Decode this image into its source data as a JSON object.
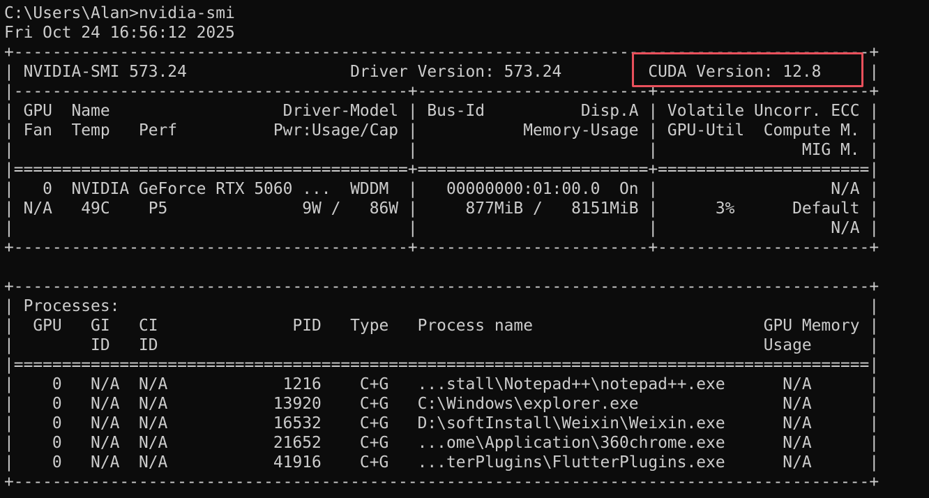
{
  "prompt": {
    "command_line": "C:\\Users\\Alan>nvidia-smi",
    "timestamp": "Fri Oct 24 16:56:12 2025"
  },
  "gpu_table": {
    "lines": [
      "+-----------------------------------------------------------------------------------------+",
      "| NVIDIA-SMI 573.24                 Driver Version: 573.24         CUDA Version: 12.8     |",
      "|-----------------------------------------+------------------------+----------------------+",
      "| GPU  Name                  Driver-Model | Bus-Id          Disp.A | Volatile Uncorr. ECC |",
      "| Fan  Temp   Perf          Pwr:Usage/Cap |           Memory-Usage | GPU-Util  Compute M. |",
      "|                                         |                        |               MIG M. |",
      "|=========================================+========================+======================|",
      "|   0  NVIDIA GeForce RTX 5060 ...  WDDM  |   00000000:01:00.0  On |                  N/A |",
      "| N/A   49C    P5              9W /   86W |     877MiB /   8151MiB |      3%      Default |",
      "|                                         |                        |                  N/A |",
      "+-----------------------------------------+------------------------+----------------------+"
    ]
  },
  "processes_table": {
    "lines": [
      "+-----------------------------------------------------------------------------------------+",
      "| Processes:                                                                              |",
      "|  GPU   GI   CI              PID   Type   Process name                        GPU Memory |",
      "|        ID   ID                                                               Usage      |",
      "|=========================================================================================|",
      "|    0   N/A  N/A            1216    C+G   ...stall\\Notepad++\\notepad++.exe      N/A      |",
      "|    0   N/A  N/A           13920    C+G   C:\\Windows\\explorer.exe               N/A      |",
      "|    0   N/A  N/A           16532    C+G   D:\\softInstall\\Weixin\\Weixin.exe      N/A      |",
      "|    0   N/A  N/A           21652    C+G   ...ome\\Application\\360chrome.exe      N/A      |",
      "|    0   N/A  N/A           41916    C+G   ...terPlugins\\FlutterPlugins.exe      N/A      |",
      "+-----------------------------------------------------------------------------------------+"
    ]
  },
  "colors": {
    "background": "#0c0c0c",
    "text": "#cccccc",
    "highlight_box": "#e8505b"
  }
}
